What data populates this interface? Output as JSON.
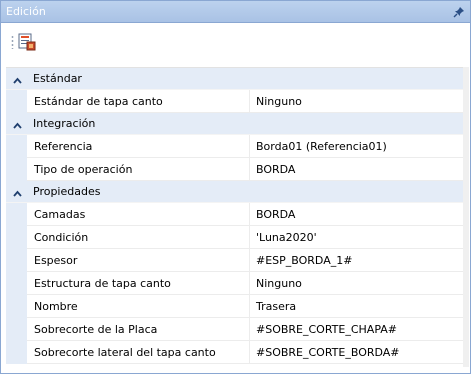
{
  "panel": {
    "title": "Edición",
    "pin_icon": "pin-icon",
    "accent": "#a9c2e5"
  },
  "toolbar": {
    "button_icon": "property-sheet-icon"
  },
  "categories": [
    {
      "label": "Estándar",
      "rows": [
        {
          "name": "Estándar de tapa canto",
          "value": "Ninguno"
        }
      ]
    },
    {
      "label": "Integración",
      "rows": [
        {
          "name": "Referencia",
          "value": "Borda01 (Referencia01)"
        },
        {
          "name": "Tipo de operación",
          "value": "BORDA"
        }
      ]
    },
    {
      "label": "Propiedades",
      "rows": [
        {
          "name": "Camadas",
          "value": "BORDA"
        },
        {
          "name": "Condición",
          "value": "'Luna2020'"
        },
        {
          "name": "Espesor",
          "value": "#ESP_BORDA_1#"
        },
        {
          "name": "Estructura de tapa canto",
          "value": "Ninguno"
        },
        {
          "name": "Nombre",
          "value": "Trasera"
        },
        {
          "name": "Sobrecorte de la Placa",
          "value": "#SOBRE_CORTE_CHAPA#"
        },
        {
          "name": "Sobrecorte lateral del tapa canto",
          "value": "#SOBRE_CORTE_BORDA#"
        }
      ]
    }
  ]
}
